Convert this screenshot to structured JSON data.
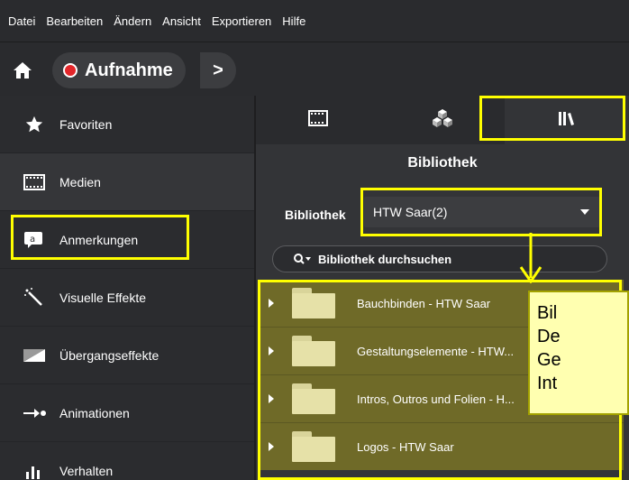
{
  "menu": [
    "Datei",
    "Bearbeiten",
    "Ändern",
    "Ansicht",
    "Exportieren",
    "Hilfe"
  ],
  "toolbar": {
    "record_label": "Aufnahme",
    "more_glyph": ">"
  },
  "sidebar": {
    "items": [
      {
        "label": "Favoriten",
        "icon": "star-icon"
      },
      {
        "label": "Medien",
        "icon": "film-icon"
      },
      {
        "label": "Anmerkungen",
        "icon": "annotation-icon"
      },
      {
        "label": "Visuelle Effekte",
        "icon": "magic-wand-icon"
      },
      {
        "label": "Übergangseffekte",
        "icon": "transition-icon"
      },
      {
        "label": "Animationen",
        "icon": "animation-arrow-icon"
      },
      {
        "label": "Verhalten",
        "icon": "behavior-icon"
      }
    ]
  },
  "panel": {
    "tabs": [
      "film-tab-icon",
      "cubes-tab-icon",
      "library-tab-icon"
    ],
    "title": "Bibliothek",
    "library_label": "Bibliothek",
    "library_selected": "HTW Saar(2)",
    "search_text": "Bibliothek durchsuchen",
    "folders": [
      "Bauchbinden - HTW Saar",
      "Gestaltungselemente - HTW...",
      "Intros, Outros und Folien - H...",
      "Logos - HTW Saar"
    ]
  },
  "callout": {
    "lines": [
      "Bil",
      "De",
      "Ge",
      "Int"
    ]
  },
  "colors": {
    "highlight": "#ffff00",
    "folder_row": "#6f6a28",
    "record": "#e3262a"
  }
}
